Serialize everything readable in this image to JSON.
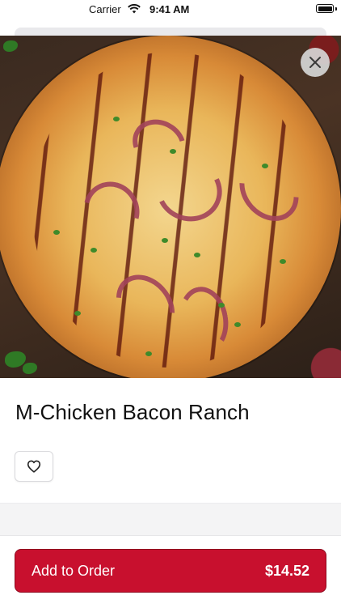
{
  "status_bar": {
    "carrier": "Carrier",
    "time": "9:41 AM"
  },
  "item": {
    "name": "M-Chicken Bacon Ranch",
    "image_alt": "BBQ chicken pizza with red onions and cilantro"
  },
  "actions": {
    "add_label": "Add to Order",
    "price": "$14.52"
  },
  "icons": {
    "close": "close-icon",
    "favorite": "heart-outline-icon",
    "wifi": "wifi-icon",
    "battery": "battery-icon"
  },
  "colors": {
    "primary": "#c8102e",
    "primary_border": "#8e0a1f",
    "band": "#f4f4f5"
  }
}
